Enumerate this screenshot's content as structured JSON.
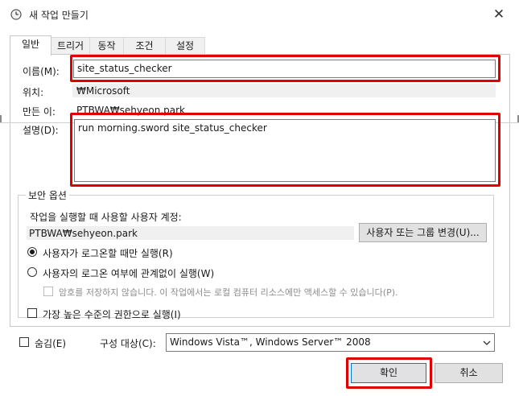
{
  "window": {
    "title": "새 작업 만들기",
    "close_glyph": "✕"
  },
  "tabs": [
    "일반",
    "트리거",
    "동작",
    "조건",
    "설정"
  ],
  "general": {
    "name_label": "이름(M):",
    "name_value": "site_status_checker",
    "location_label": "위치:",
    "location_value": "₩Microsoft",
    "author_label": "만든 이:",
    "author_value": "PTBWA₩sehyeon.park",
    "description_label": "설명(D):",
    "description_value": "run morning.sword site_status_checker"
  },
  "security": {
    "group_title": "보안 옵션",
    "account_prompt": "작업을 실행할 때 사용할 사용자 계정:",
    "account_value": "PTBWA₩sehyeon.park",
    "change_button": "사용자 또는 그룹 변경(U)...",
    "radio_logged_on": "사용자가 로그온할 때만 실행(R)",
    "radio_whether": "사용자의 로그온 여부에 관계없이 실행(W)",
    "no_password": "암호를 저장하지 않습니다. 이 작업에서는 로컬 컴퓨터 리소스에만 액세스할 수 있습니다(P).",
    "highest_priv": "가장 높은 수준의 권한으로 실행(I)",
    "selected_radio": "logged_on"
  },
  "footer": {
    "hidden_label": "숨김(E)",
    "configure_label": "구성 대상(C):",
    "configure_value": "Windows Vista™, Windows Server™ 2008",
    "ok_button": "확인",
    "cancel_button": "취소"
  },
  "colors": {
    "highlight": "#e00000",
    "button_face": "#e1e1e1",
    "readonly_bg": "#f0f0f0"
  }
}
